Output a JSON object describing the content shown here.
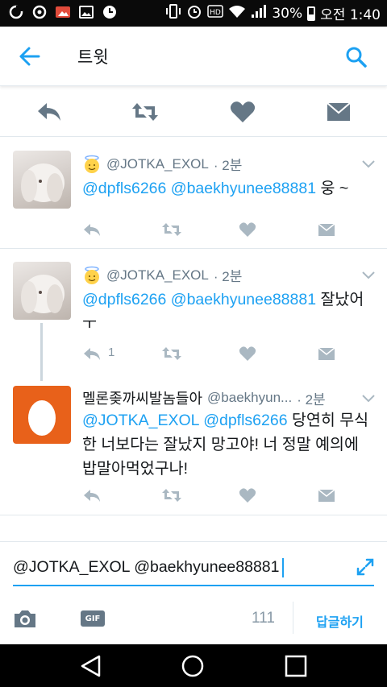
{
  "status_bar": {
    "battery": "30%",
    "time": "오전 1:40",
    "icons": [
      "notification-icon",
      "chrome-icon",
      "photo-icon",
      "gallery-icon",
      "clock-app-icon",
      "vibrate-icon",
      "alarm-icon",
      "hd-icon",
      "wifi-icon",
      "signal-icon",
      "battery-icon"
    ]
  },
  "header": {
    "title": "트윗"
  },
  "tweets": [
    {
      "handle": "@JOTKA_EXOL",
      "time": "· 2분",
      "mentions": "@dpfls6266 @baekhyunee88881",
      "text": " 웅 ~"
    },
    {
      "handle": "@JOTKA_EXOL",
      "time": "· 2분",
      "mentions": "@dpfls6266 @baekhyunee88881",
      "text": " 잘났어 ㅜ",
      "reply_count": "1"
    },
    {
      "display_name": "멜론좆까씨발놈들아",
      "handle": "@baekhyun...",
      "time": "· 2분",
      "mentions": "@JOTKA_EXOL @dpfls6266",
      "text": " 당연히 무식한 너보다는 잘났지 망고야! 너 정말 예의에 밥말아먹었구나!"
    }
  ],
  "compose": {
    "value": "@JOTKA_EXOL @baekhyunee88881",
    "gif_label": "GIF",
    "char_count": "111",
    "reply_button": "답글하기"
  },
  "colors": {
    "accent": "#1da1f2",
    "icon_gray": "#657786",
    "light_icon": "#aab8c2",
    "egg_orange": "#e8611a"
  }
}
